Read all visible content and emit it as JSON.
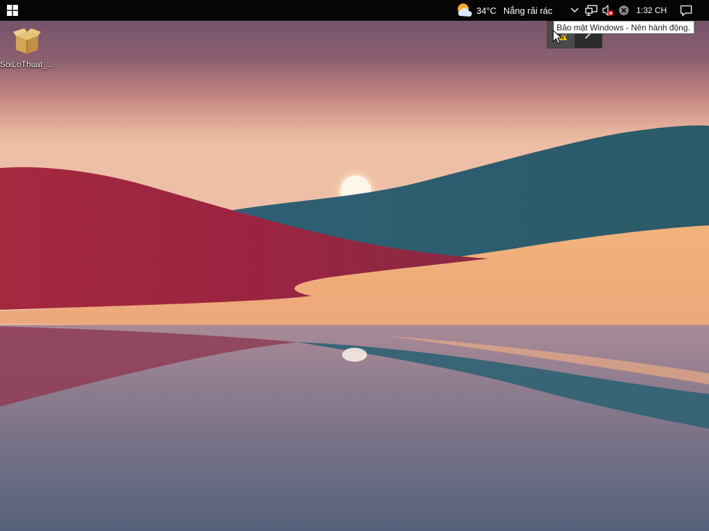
{
  "desktop": {
    "icons": [
      {
        "label": "SoiLoThuat_...",
        "icon": "package-box-icon"
      }
    ]
  },
  "taskbar": {
    "start_icon": "windows-logo-icon",
    "weather": {
      "icon": "partly-sunny-icon",
      "temperature": "34°C",
      "condition": "Nắng rải rác"
    },
    "tray": {
      "chevron_icon": "chevron-down-icon",
      "network_icon": "network-icon",
      "volume_icon": "volume-muted-icon",
      "status_icon": "error-circle-icon"
    },
    "clock": "1:32 CH",
    "notification_icon": "action-center-icon"
  },
  "tray_flyout": {
    "items": [
      {
        "icon": "windows-security-warning-icon"
      },
      {
        "icon": "pen-icon"
      }
    ]
  },
  "tooltip": {
    "text": "Bảo mật Windows - Nên hành động."
  },
  "colors": {
    "taskbar_bg": "#050505",
    "warning": "#f2c200",
    "error": "#e81123"
  }
}
